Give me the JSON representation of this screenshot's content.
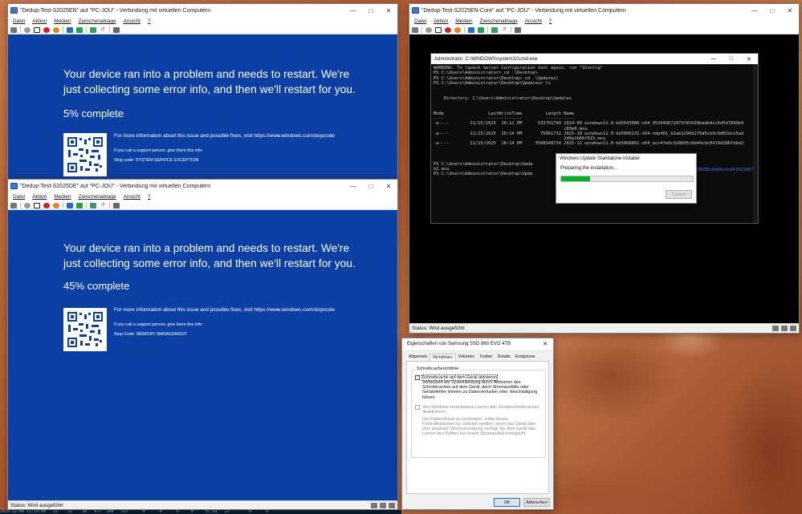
{
  "menu": [
    "Datei",
    "Aktion",
    "Medien",
    "Zwischenablage",
    "Ansicht",
    "?"
  ],
  "bsod_common": {
    "message": "Your device ran into a problem and needs to restart. We're just collecting some error info, and then we'll restart for you.",
    "more_info": "For more information about this issue and possible fixes, visit https://www.windows.com/stopcode",
    "support": "If you call a support person, give them this info:"
  },
  "vm1": {
    "title": "\"Dedup-Test-S2025EN\" auf \"PC-JOU\" - Verbindung mit virtuellen Computern",
    "progress": "5% complete",
    "stop_code": "Stop code: SYSTEM SERVICE EXCEPTION"
  },
  "vm2": {
    "title": "\"Dedup-Test-S2025DE\" auf \"PC-JOU\" - Verbindung mit virtuellen Computern",
    "progress": "45% complete",
    "progress_value": 45,
    "stop_code": "Stop Code: MEMORY MANAGEMENT",
    "status": "Status: Wird ausgeführt"
  },
  "vm3": {
    "title": "\"Dedup-Test-S2025EN-Core\" auf \"PC-JOU\" - Verbindung mit virtuellen Computern",
    "status": "Status: Wird ausgeführt",
    "cmd_title": "Administrator: C:\\WINDOWS\\system32\\cmd.exe",
    "cmd_output": "WARNING: To launch Server Configuration tool again, run \"SConfig\"\nPS C:\\Users\\Administrator> cd .\\Desktop\\\nPS C:\\Users\\Administrator\\Desktop> cd .\\Updates\\\nPS C:\\Users\\Administrator\\Desktop\\Updates> ls\n\n\n    Directory: C:\\Users\\Administrator\\Desktop\\Updates\n\n\nMode                 LastWriteTime         Length Name\n----                 -------------         ------ ----\n-a----        11/15/2025  10:12 PM      533761740 2024-09 windows11.0-kb5043080-x64_953449672073f8fb99badb4cc6d5d7849b9\n                                                  c83e0.msu\n-a----        11/15/2025  10:14 PM       75061732 2025-10 windows11.0-kb5066131-x64-ndp481_b2ab1290d276d5cb9c9d03dce5ad\n                                                  2d6e2b66f615.msu\n-a----        11/15/2025  10:14 PM     3568349734 2025-11 windows11.0-kb5068861-x64_acc4fe9c928835c0d44cdc0419d1867dbd2\n\n\n\nPS C:\\Users\\Administrator\\Desktop\\Upda\nb2.msu\nPS C:\\Users\\Administrator\\Desktop\\Upda",
    "cmd_tail": "28835c0d44cdc0419d1867dbd2b62",
    "wu_title": "Windows Update Standalone Installer",
    "wu_text": "Preparing the installation...",
    "wu_progress": 0.22,
    "wu_cancel": "Cancel"
  },
  "props": {
    "title": "Eigenschaften von Samsung SSD 860 EVO 4TB",
    "tabs": [
      "Allgemein",
      "Richtlinien",
      "Volumes",
      "Treiber",
      "Details",
      "Ereignisse"
    ],
    "active_tab": "Richtlinien",
    "group_label": "Schreibcacherichtlinie",
    "opt1": "Schreibcache auf dem Gerät aktivieren",
    "opt1_desc": "Verbessert die Systemleistung durch Aktivieren des Schreibcaches auf dem Gerät, doch Stromausfälle oder Gerätefehler können zu Datenverlusten oder -beschädigung führen.",
    "opt2": "Von Windows veranlasstes Leeren des Geräteschreibcaches deaktivieren",
    "opt2_desc": "Um Datenverlust zu verhindern, sollte dieses Kontrollkästchen nur aktiviert werden, wenn das Gerät über eine separate Stromversorgung verfügt, die dem Gerät das Leeren des Puffers bei einem Stromausfall ermöglicht.",
    "ok": "OK",
    "cancel": "Abbrechen"
  },
  "bottom_strip": "2025-12-06 11:15:00   11    21    16   677  100   727      0     -9      0     0     57.91   27        0      0"
}
